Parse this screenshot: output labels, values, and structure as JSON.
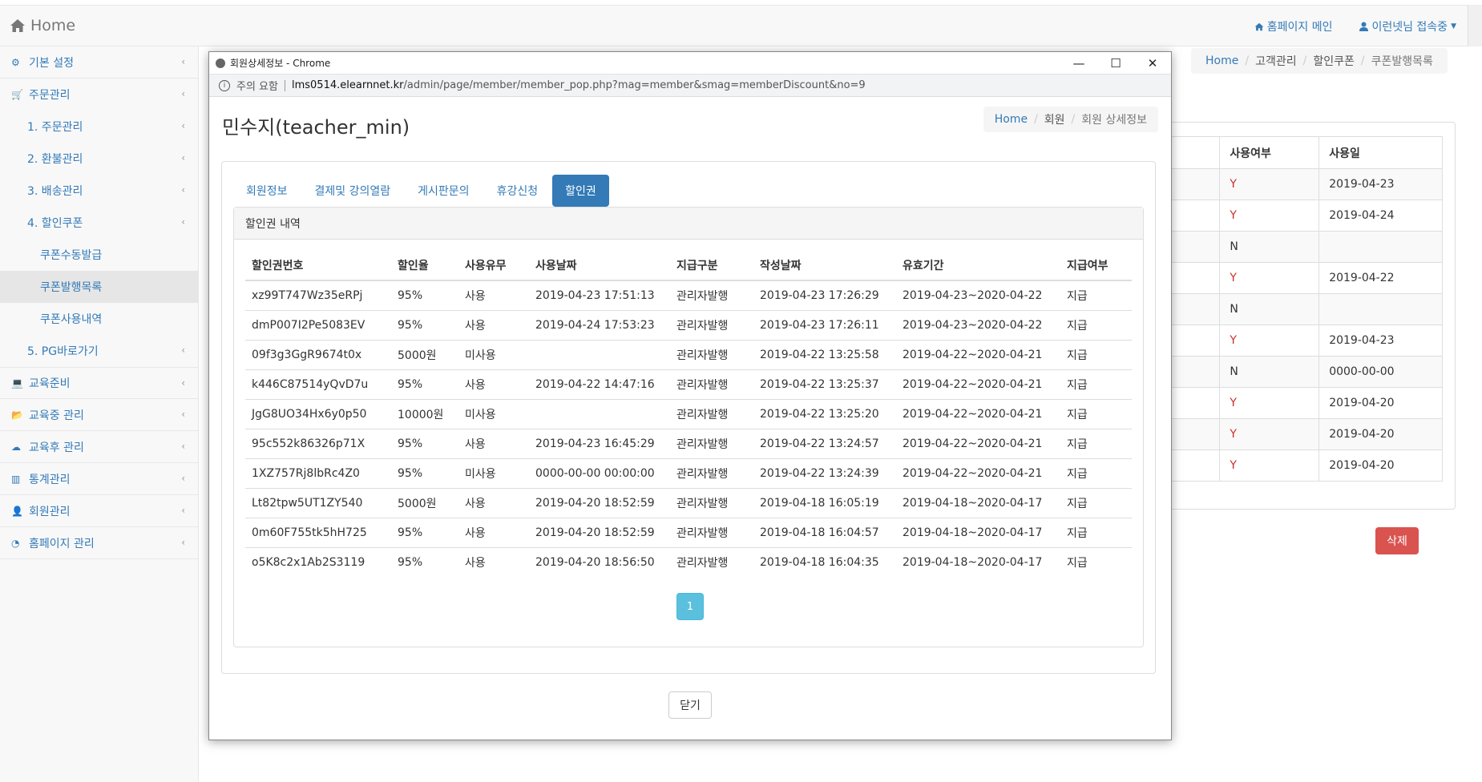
{
  "topbar": {
    "brand": "Home",
    "nav": [
      {
        "icon": "home-icon",
        "label": "홈페이지 메인"
      },
      {
        "icon": "user-icon",
        "label": "이런넷님 접속중"
      }
    ]
  },
  "sidebar": {
    "items": [
      {
        "label": "기본 설정",
        "icon": "gears-icon"
      },
      {
        "label": "주문관리",
        "icon": "cart-icon"
      },
      {
        "label": "1. 주문관리"
      },
      {
        "label": "2. 환불관리"
      },
      {
        "label": "3. 배송관리"
      },
      {
        "label": "4. 할인쿠폰"
      },
      {
        "label": "쿠폰수동발급"
      },
      {
        "label": "쿠폰발행목록"
      },
      {
        "label": "쿠폰사용내역"
      },
      {
        "label": "5. PG바로가기"
      },
      {
        "label": "교육준비",
        "icon": "laptop-icon"
      },
      {
        "label": "교육중 관리",
        "icon": "folder-open-icon"
      },
      {
        "label": "교육후 관리",
        "icon": "cloud-upload-icon"
      },
      {
        "label": "통계관리",
        "icon": "bar-chart-icon"
      },
      {
        "label": "회원관리",
        "icon": "user-icon"
      },
      {
        "label": "홈페이지 관리",
        "icon": "dashboard-icon"
      }
    ]
  },
  "background": {
    "breadcrumb": [
      "Home",
      "고객관리",
      "할인쿠폰",
      "쿠폰발행목록"
    ],
    "table": {
      "headers": [
        "",
        "사용여부",
        "사용일"
      ],
      "rows": [
        [
          "",
          "Y",
          "2019-04-23"
        ],
        [
          "",
          "Y",
          "2019-04-24"
        ],
        [
          "",
          "N",
          ""
        ],
        [
          "",
          "Y",
          "2019-04-22"
        ],
        [
          "",
          "N",
          ""
        ],
        [
          "",
          "Y",
          "2019-04-23"
        ],
        [
          "",
          "N",
          "0000-00-00"
        ],
        [
          "",
          "Y",
          "2019-04-20"
        ],
        [
          "",
          "Y",
          "2019-04-20"
        ],
        [
          "",
          "Y",
          "2019-04-20"
        ]
      ]
    },
    "delete_label": "삭제"
  },
  "popup": {
    "window_title": "회원상세정보 - Chrome",
    "url_warning": "주의 요함",
    "url_host": "lms0514.elearnnet.kr",
    "url_path": "/admin/page/member/member_pop.php?mag=member&smag=memberDiscount&no=9",
    "title": "민수지(teacher_min)",
    "breadcrumb": [
      "Home",
      "회원",
      "회원 상세정보"
    ],
    "tabs": [
      "회원정보",
      "결제및 강의열람",
      "게시판문의",
      "휴강신청",
      "할인권"
    ],
    "active_tab": "할인권",
    "panel_heading": "할인권 내역",
    "table": {
      "headers": [
        "할인권번호",
        "할인율",
        "사용유무",
        "사용날짜",
        "지급구분",
        "작성날짜",
        "유효기간",
        "지급여부"
      ],
      "rows": [
        [
          "xz99T747Wz35eRPj",
          "95%",
          "사용",
          "2019-04-23 17:51:13",
          "관리자발행",
          "2019-04-23 17:26:29",
          "2019-04-23~2020-04-22",
          "지급"
        ],
        [
          "dmP007I2Pe5083EV",
          "95%",
          "사용",
          "2019-04-24 17:53:23",
          "관리자발행",
          "2019-04-23 17:26:11",
          "2019-04-23~2020-04-22",
          "지급"
        ],
        [
          "09f3g3GgR9674t0x",
          "5000원",
          "미사용",
          "",
          "관리자발행",
          "2019-04-22 13:25:58",
          "2019-04-22~2020-04-21",
          "지급"
        ],
        [
          "k446C87514yQvD7u",
          "95%",
          "사용",
          "2019-04-22 14:47:16",
          "관리자발행",
          "2019-04-22 13:25:37",
          "2019-04-22~2020-04-21",
          "지급"
        ],
        [
          "JgG8UO34Hx6y0p50",
          "10000원",
          "미사용",
          "",
          "관리자발행",
          "2019-04-22 13:25:20",
          "2019-04-22~2020-04-21",
          "지급"
        ],
        [
          "95c552k86326p71X",
          "95%",
          "사용",
          "2019-04-23 16:45:29",
          "관리자발행",
          "2019-04-22 13:24:57",
          "2019-04-22~2020-04-21",
          "지급"
        ],
        [
          "1XZ757Rj8lbRc4Z0",
          "95%",
          "미사용",
          "0000-00-00 00:00:00",
          "관리자발행",
          "2019-04-22 13:24:39",
          "2019-04-22~2020-04-21",
          "지급"
        ],
        [
          "Lt82tpw5UT1ZY540",
          "5000원",
          "사용",
          "2019-04-20 18:52:59",
          "관리자발행",
          "2019-04-18 16:05:19",
          "2019-04-18~2020-04-17",
          "지급"
        ],
        [
          "0m60F755tk5hH725",
          "95%",
          "사용",
          "2019-04-20 18:52:59",
          "관리자발행",
          "2019-04-18 16:04:57",
          "2019-04-18~2020-04-17",
          "지급"
        ],
        [
          "o5K8c2x1Ab2S3119",
          "95%",
          "사용",
          "2019-04-20 18:56:50",
          "관리자발행",
          "2019-04-18 16:04:35",
          "2019-04-18~2020-04-17",
          "지급"
        ]
      ]
    },
    "pagination": [
      "1"
    ],
    "close_label": "닫기"
  },
  "colors": {
    "link": "#337ab7",
    "used": "#c9302c",
    "active_tab": "#337ab7",
    "page_active": "#5bc0de",
    "danger": "#d9534f"
  }
}
